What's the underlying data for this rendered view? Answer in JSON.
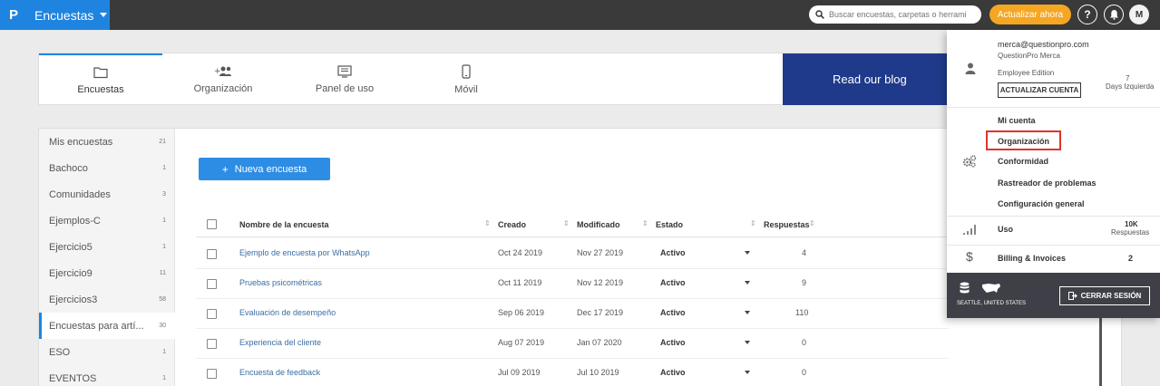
{
  "topbar": {
    "brand_logo": "P",
    "brand_title": "Encuestas",
    "search_placeholder": "Buscar encuestas, carpetas o herrami",
    "upgrade_label": "Actualizar ahora",
    "help_label": "?",
    "avatar_initial": "M"
  },
  "tabs": {
    "items": [
      {
        "label": "Encuestas",
        "icon": "folder-icon"
      },
      {
        "label": "Organización",
        "icon": "add-group-icon"
      },
      {
        "label": "Panel de uso",
        "icon": "dashboard-icon"
      },
      {
        "label": "Móvil",
        "icon": "mobile-icon"
      }
    ],
    "blog_label": "Read our blog"
  },
  "sidebar": {
    "items": [
      {
        "label": "Mis encuestas",
        "count": "21"
      },
      {
        "label": "Bachoco",
        "count": "1"
      },
      {
        "label": "Comunidades",
        "count": "3"
      },
      {
        "label": "Ejemplos-C",
        "count": "1"
      },
      {
        "label": "Ejercicio5",
        "count": "1"
      },
      {
        "label": "Ejercicio9",
        "count": "11"
      },
      {
        "label": "Ejercicios3",
        "count": "58"
      },
      {
        "label": "Encuestas para artí...",
        "count": "30"
      },
      {
        "label": "ESO",
        "count": "1"
      },
      {
        "label": "EVENTOS",
        "count": "1"
      }
    ]
  },
  "main": {
    "new_button_label": "Nueva encuesta",
    "columns": {
      "name": "Nombre de la encuesta",
      "created": "Creado",
      "modified": "Modificado",
      "status": "Estado",
      "responses": "Respuestas"
    },
    "sort_glyph": "⇕",
    "rows": [
      {
        "name": "Ejemplo de encuesta por WhatsApp",
        "created": "Oct 24 2019",
        "modified": "Nov 27 2019",
        "status": "Activo",
        "responses": "4"
      },
      {
        "name": "Pruebas psicométricas",
        "created": "Oct 11 2019",
        "modified": "Nov 12 2019",
        "status": "Activo",
        "responses": "9"
      },
      {
        "name": "Evaluación de desempeño",
        "created": "Sep 06 2019",
        "modified": "Dec 17 2019",
        "status": "Activo",
        "responses": "110"
      },
      {
        "name": "Experiencia del cliente",
        "created": "Aug 07 2019",
        "modified": "Jan 07 2020",
        "status": "Activo",
        "responses": "0"
      },
      {
        "name": "Encuesta de feedback",
        "created": "Jul 09 2019",
        "modified": "Jul 10 2019",
        "status": "Activo",
        "responses": "0"
      }
    ]
  },
  "dropdown": {
    "email": "merca@questionpro.com",
    "account": "QuestionPro Merca",
    "edition": "Employee Edition",
    "days_count": "7",
    "days_label": "Days Izquierda",
    "update_account_label": "ACTUALIZAR CUENTA",
    "links": [
      "Mi cuenta",
      "Organización",
      "Conformidad",
      "Rastreador de problemas",
      "Configuración general"
    ],
    "usage_label": "Uso",
    "usage_value": "10K",
    "usage_unit": "Respuestas",
    "billing_label": "Billing & Invoices",
    "billing_count": "2",
    "location": "SEATTLE, UNITED STATES",
    "logout_label": "CERRAR SESIÓN"
  },
  "colors": {
    "brand_blue": "#1f84e0",
    "topbar": "#3a3a3a",
    "upgrade_orange": "#f5a623",
    "blog_navy": "#1f3a8a",
    "highlight_red": "#e0342a"
  }
}
